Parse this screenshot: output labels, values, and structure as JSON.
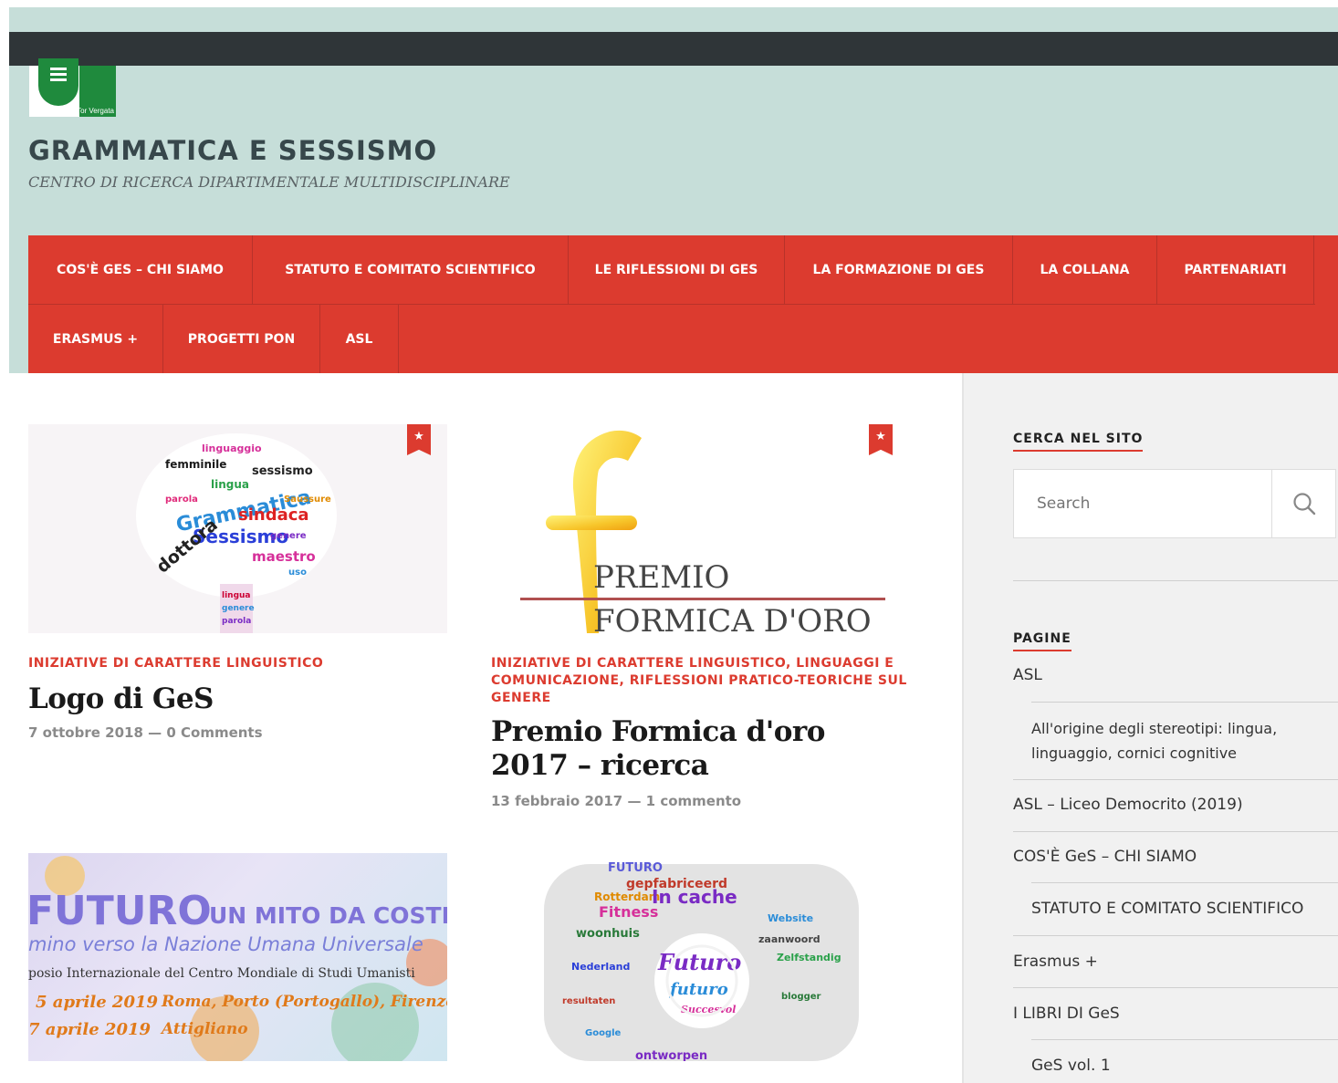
{
  "logo": {
    "subtext": "Tor Vergata"
  },
  "site": {
    "title": "GRAMMATICA E SESSISMO",
    "tagline": "CENTRO DI RICERCA DIPARTIMENTALE MULTIDISCIPLINARE"
  },
  "nav": {
    "row1": [
      "COS'È GES – CHI SIAMO",
      "STATUTO E COMITATO SCIENTIFICO",
      "LE RIFLESSIONI DI GES",
      "LA FORMAZIONE DI GES",
      "LA COLLANA",
      "PARTENARIATI"
    ],
    "row2": [
      "ERASMUS +",
      "PROGETTI PON",
      "ASL"
    ]
  },
  "posts": [
    {
      "category": "INIZIATIVE DI CARATTERE LINGUISTICO",
      "title": "Logo di GeS",
      "date": "7 ottobre 2018",
      "comments": "0 Comments",
      "image_words": [
        "Grammatica",
        "sindaca",
        "Sessismo",
        "dottora",
        "maestro",
        "sessismo",
        "lingua"
      ]
    },
    {
      "category": "INIZIATIVE DI CARATTERE LINGUISTICO, LINGUAGGI E COMUNICAZIONE, RIFLESSIONI PRATICO-TEORICHE SUL GENERE",
      "title": "Premio Formica d'oro 2017 – ricerca",
      "date": "13 febbraio 2017",
      "comments": "1 commento",
      "image_text": [
        "PREMIO",
        "FORMICA D'ORO"
      ]
    },
    {
      "image_text": [
        "FUTURO",
        "UN MITO DA COSTRU",
        "mino verso la Nazione Umana Universale",
        "posio Internazionale del Centro Mondiale di Studi Umanisti",
        "5 aprile 2019",
        "Roma, Porto (Portogallo), Firenze",
        "7 aprile 2019",
        "Attigliano"
      ]
    },
    {
      "image_words": [
        "In cache",
        "Futuro",
        "futuro",
        "Fitness",
        "Rotterdam",
        "woonhuis",
        "Nederland",
        "gepfabriceerd",
        "Zelfstandig",
        "ontworpen"
      ]
    }
  ],
  "sidebar": {
    "search_title": "CERCA NEL SITO",
    "search_placeholder": "Search",
    "pages_title": "PAGINE",
    "pages": [
      {
        "label": "ASL",
        "level": 0
      },
      {
        "label": "All'origine degli stereotipi: lingua, linguaggio, cornici cognitive",
        "level": 1
      },
      {
        "label": "ASL – Liceo Democrito (2019)",
        "level": 0
      },
      {
        "label": "COS'È GeS – CHI SIAMO",
        "level": 0
      },
      {
        "label": "STATUTO E COMITATO SCIENTIFICO",
        "level": 1
      },
      {
        "label": "Erasmus +",
        "level": 0
      },
      {
        "label": "I LIBRI DI GeS",
        "level": 0
      },
      {
        "label": "GeS vol. 1",
        "level": 1
      }
    ]
  },
  "colors": {
    "accent": "#dc3b2f",
    "header_bg": "#c6ded9",
    "topbar": "#2f3538"
  }
}
